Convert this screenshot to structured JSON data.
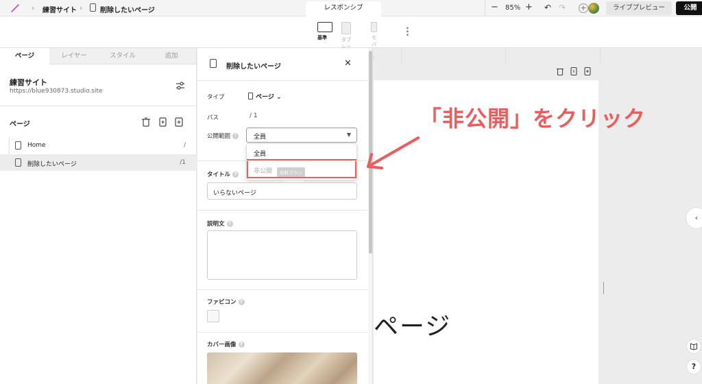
{
  "topbar": {
    "site_name": "練習サイト",
    "page_name": "削除したいページ",
    "responsive_tab": "レスポンシブ",
    "zoom": "85%",
    "live_preview": "ライブプレビュー",
    "publish": "公開"
  },
  "devices": [
    {
      "label": "基準",
      "active": true
    },
    {
      "label": "タブレット",
      "active": false
    },
    {
      "label": "モバイル",
      "active": false
    }
  ],
  "left_panel": {
    "tabs": [
      "ページ",
      "レイヤー",
      "スタイル",
      "追加"
    ],
    "site_title": "練習サイト",
    "site_url": "https://blue930873.studio.site",
    "pages_heading": "ページ",
    "pages": [
      {
        "name": "Home",
        "path": "/"
      },
      {
        "name": "削除したいページ",
        "path": "/1"
      }
    ]
  },
  "settings_panel": {
    "title": "削除したいページ",
    "type_label": "タイプ",
    "type_value": "ページ",
    "path_label": "パス",
    "path_value": "/ 1",
    "visibility_label": "公開範囲",
    "visibility_value": "全員",
    "visibility_options": [
      "全員",
      "非公開"
    ],
    "paid_badge": "有料プラン",
    "tooltip": "非公開",
    "title_label": "タイトル",
    "title_value": "いらないページ",
    "description_label": "説明文",
    "favicon_label": "ファビコン",
    "cover_label": "カバー画像"
  },
  "canvas": {
    "page_text": "ページ"
  },
  "annotation": {
    "text": "「非公開」をクリック",
    "color": "#ef5a5a"
  }
}
